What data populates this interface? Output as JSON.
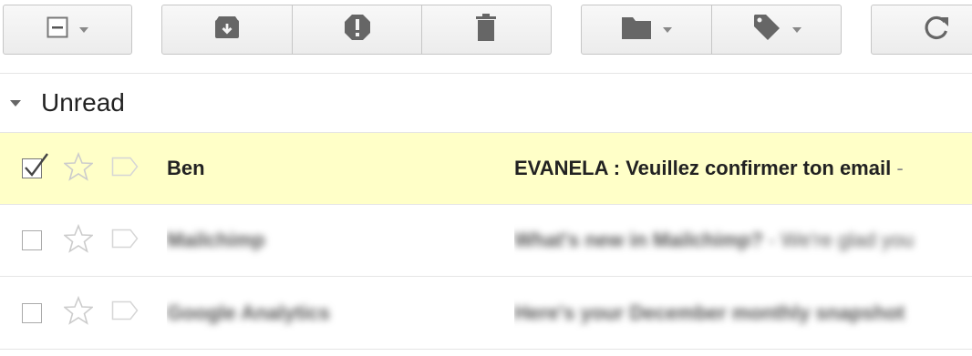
{
  "toolbar": {
    "groups": [
      {
        "name": "select",
        "buttons": [
          "select-checkbox-icon"
        ]
      },
      {
        "name": "actions",
        "buttons": [
          "archive-icon",
          "report-spam-icon",
          "delete-icon"
        ]
      },
      {
        "name": "organize",
        "buttons": [
          "folder-icon",
          "label-tag-icon"
        ]
      },
      {
        "name": "refresh",
        "buttons": [
          "refresh-icon"
        ]
      }
    ]
  },
  "section": {
    "title": "Unread"
  },
  "emails": [
    {
      "selected": true,
      "sender": "Ben",
      "subject": "EVANELA : Veuillez confirmer ton email",
      "separator": " - ",
      "snippet": "",
      "blurred": false
    },
    {
      "selected": false,
      "sender": "Mailchimp",
      "subject": "What's new in Mailchimp?",
      "separator": " - ",
      "snippet": "We're glad you",
      "blurred": true
    },
    {
      "selected": false,
      "sender": "Google Analytics",
      "subject": "Here's your December monthly snapshot",
      "separator": "",
      "snippet": "",
      "blurred": true
    }
  ],
  "colors": {
    "selected_row": "#ffffc8",
    "icon": "#666666"
  }
}
